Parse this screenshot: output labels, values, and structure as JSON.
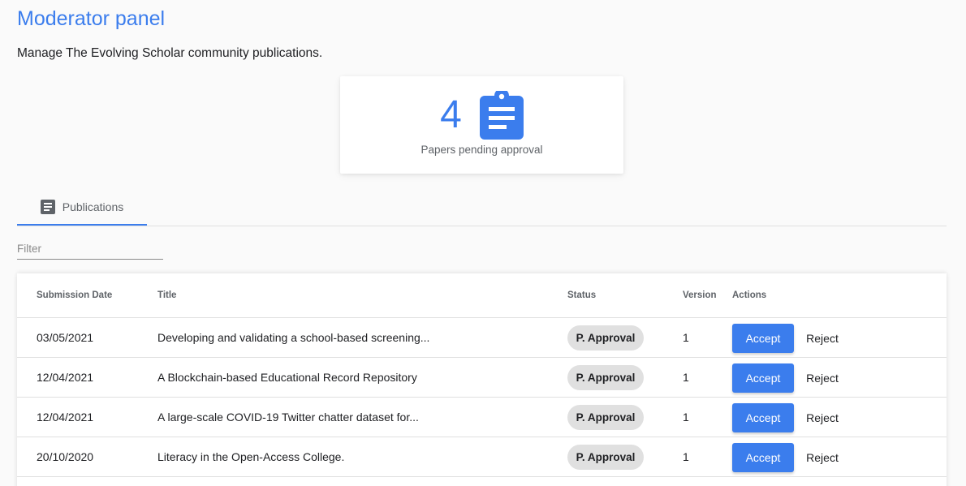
{
  "header": {
    "title": "Moderator panel",
    "subtitle": "Manage The Evolving Scholar community publications."
  },
  "stat": {
    "value": "4",
    "label": "Papers pending approval",
    "icon": "clipboard-icon",
    "color": "#3b7ded"
  },
  "tabs": [
    {
      "label": "Publications",
      "icon": "article-icon",
      "active": true
    }
  ],
  "filter": {
    "placeholder": "Filter",
    "value": ""
  },
  "table": {
    "columns": [
      "Submission Date",
      "Title",
      "Status",
      "Version",
      "Actions"
    ],
    "accept_label": "Accept",
    "reject_label": "Reject",
    "rows": [
      {
        "date": "03/05/2021",
        "title": "Developing and validating a school-based screening...",
        "status": "P. Approval",
        "version": "1"
      },
      {
        "date": "12/04/2021",
        "title": "A Blockchain-based Educational Record Repository",
        "status": "P. Approval",
        "version": "1"
      },
      {
        "date": "12/04/2021",
        "title": "A large-scale COVID-19 Twitter chatter dataset for...",
        "status": "P. Approval",
        "version": "1"
      },
      {
        "date": "20/10/2020",
        "title": "Literacy in the Open-Access College.",
        "status": "P. Approval",
        "version": "1"
      }
    ]
  }
}
